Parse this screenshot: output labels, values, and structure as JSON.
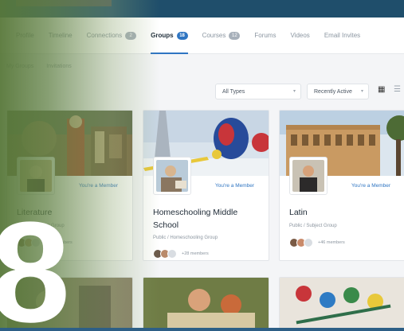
{
  "nav": {
    "tabs": [
      {
        "label": "Profile",
        "badge": ""
      },
      {
        "label": "Timeline",
        "badge": ""
      },
      {
        "label": "Connections",
        "badge": "2"
      },
      {
        "label": "Groups",
        "badge": "18"
      },
      {
        "label": "Courses",
        "badge": "12"
      },
      {
        "label": "Forums",
        "badge": ""
      },
      {
        "label": "Videos",
        "badge": ""
      },
      {
        "label": "Email Invites",
        "badge": ""
      }
    ]
  },
  "subnav": {
    "my_groups": "My Groups",
    "invitations": "Invitations"
  },
  "filters": {
    "type": "All Types",
    "sort": "Recently Active"
  },
  "cards": [
    {
      "title": "Literature",
      "member_label": "You're a Member",
      "meta": "Public / Subject Group",
      "members": "+17 members"
    },
    {
      "title": "Homeschooling Middle School",
      "member_label": "You're a Member",
      "meta": "Public / Homeschooling Group",
      "members": "+28 members"
    },
    {
      "title": "Latin",
      "member_label": "You're a Member",
      "meta": "Public / Subject Group",
      "members": "+46 members"
    }
  ],
  "overlay": {
    "number": "8"
  },
  "colors": {
    "accent": "#2f75c2",
    "header": "#1f4e6b",
    "overlay_green": "#58783a"
  }
}
